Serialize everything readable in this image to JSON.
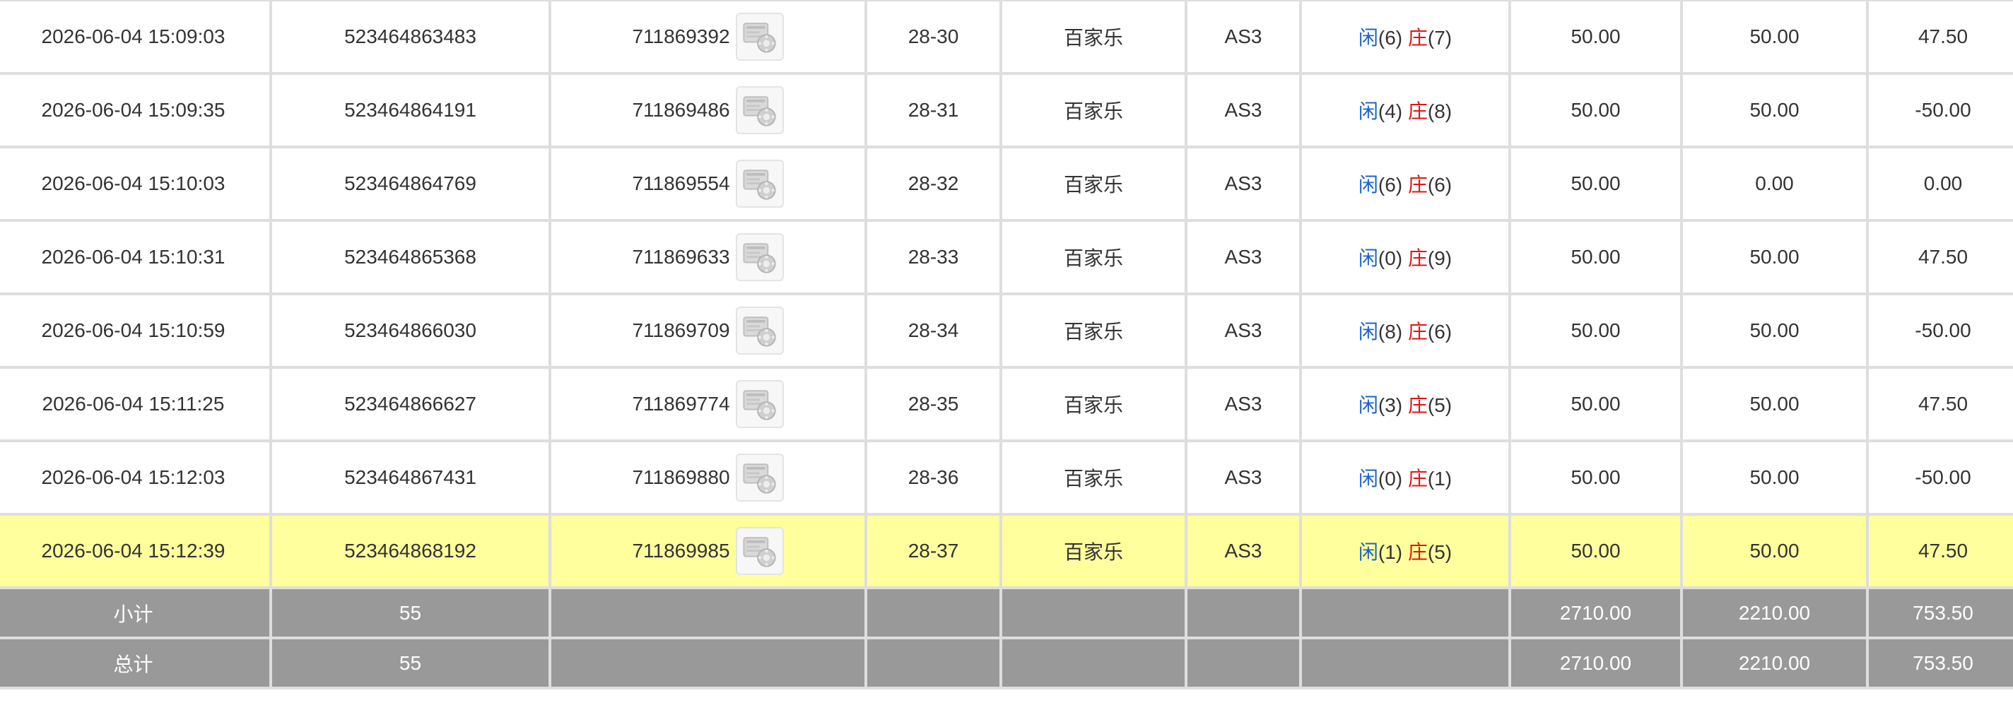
{
  "rows": [
    {
      "time": "2026-06-04 15:09:03",
      "order_no": "523464863483",
      "round_id": "711869392",
      "shoe": "28-30",
      "game": "百家乐",
      "table": "AS3",
      "player_label": "闲",
      "player_pts": "(6)",
      "banker_label": "庄",
      "banker_pts": "(7)",
      "bet": "50.00",
      "valid_bet": "50.00",
      "win_loss": "47.50",
      "win_loss_negative": false,
      "highlight": false
    },
    {
      "time": "2026-06-04 15:09:35",
      "order_no": "523464864191",
      "round_id": "711869486",
      "shoe": "28-31",
      "game": "百家乐",
      "table": "AS3",
      "player_label": "闲",
      "player_pts": "(4)",
      "banker_label": "庄",
      "banker_pts": "(8)",
      "bet": "50.00",
      "valid_bet": "50.00",
      "win_loss": "-50.00",
      "win_loss_negative": true,
      "highlight": false
    },
    {
      "time": "2026-06-04 15:10:03",
      "order_no": "523464864769",
      "round_id": "711869554",
      "shoe": "28-32",
      "game": "百家乐",
      "table": "AS3",
      "player_label": "闲",
      "player_pts": "(6)",
      "banker_label": "庄",
      "banker_pts": "(6)",
      "bet": "50.00",
      "valid_bet": "0.00",
      "win_loss": "0.00",
      "win_loss_negative": false,
      "highlight": false
    },
    {
      "time": "2026-06-04 15:10:31",
      "order_no": "523464865368",
      "round_id": "711869633",
      "shoe": "28-33",
      "game": "百家乐",
      "table": "AS3",
      "player_label": "闲",
      "player_pts": "(0)",
      "banker_label": "庄",
      "banker_pts": "(9)",
      "bet": "50.00",
      "valid_bet": "50.00",
      "win_loss": "47.50",
      "win_loss_negative": false,
      "highlight": false
    },
    {
      "time": "2026-06-04 15:10:59",
      "order_no": "523464866030",
      "round_id": "711869709",
      "shoe": "28-34",
      "game": "百家乐",
      "table": "AS3",
      "player_label": "闲",
      "player_pts": "(8)",
      "banker_label": "庄",
      "banker_pts": "(6)",
      "bet": "50.00",
      "valid_bet": "50.00",
      "win_loss": "-50.00",
      "win_loss_negative": true,
      "highlight": false
    },
    {
      "time": "2026-06-04 15:11:25",
      "order_no": "523464866627",
      "round_id": "711869774",
      "shoe": "28-35",
      "game": "百家乐",
      "table": "AS3",
      "player_label": "闲",
      "player_pts": "(3)",
      "banker_label": "庄",
      "banker_pts": "(5)",
      "bet": "50.00",
      "valid_bet": "50.00",
      "win_loss": "47.50",
      "win_loss_negative": false,
      "highlight": false
    },
    {
      "time": "2026-06-04 15:12:03",
      "order_no": "523464867431",
      "round_id": "711869880",
      "shoe": "28-36",
      "game": "百家乐",
      "table": "AS3",
      "player_label": "闲",
      "player_pts": "(0)",
      "banker_label": "庄",
      "banker_pts": "(1)",
      "bet": "50.00",
      "valid_bet": "50.00",
      "win_loss": "-50.00",
      "win_loss_negative": true,
      "highlight": false
    },
    {
      "time": "2026-06-04 15:12:39",
      "order_no": "523464868192",
      "round_id": "711869985",
      "shoe": "28-37",
      "game": "百家乐",
      "table": "AS3",
      "player_label": "闲",
      "player_pts": "(1)",
      "banker_label": "庄",
      "banker_pts": "(5)",
      "bet": "50.00",
      "valid_bet": "50.00",
      "win_loss": "47.50",
      "win_loss_negative": false,
      "highlight": true
    }
  ],
  "subtotal": {
    "label": "小计",
    "count": "55",
    "bet": "2710.00",
    "valid_bet": "2210.00",
    "win_loss": "753.50"
  },
  "total": {
    "label": "总计",
    "count": "55",
    "bet": "2710.00",
    "valid_bet": "2210.00",
    "win_loss": "753.50"
  },
  "icons": {
    "detail": "card-result-icon"
  },
  "colors": {
    "highlight_row": "#ffff9d",
    "total_row_bg": "#999999",
    "player": "#1b63c8",
    "banker": "#e01414",
    "negative": "#e01414"
  }
}
